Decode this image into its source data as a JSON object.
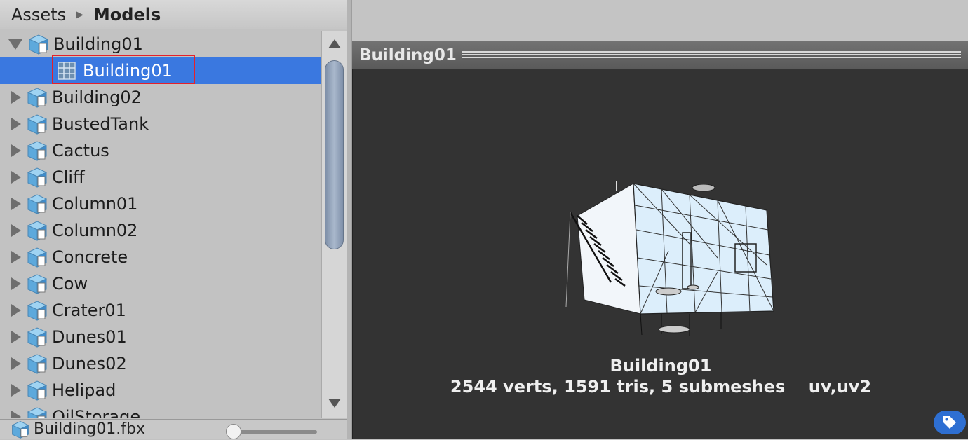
{
  "breadcrumb": {
    "root": "Assets",
    "current": "Models"
  },
  "tree": {
    "expanded_item": "Building01",
    "child_mesh": "Building01",
    "items": [
      "Building02",
      "BustedTank",
      "Cactus",
      "Cliff",
      "Column01",
      "Column02",
      "Concrete",
      "Cow",
      "Crater01",
      "Dunes01",
      "Dunes02",
      "Helipad",
      "OilStorage"
    ]
  },
  "bottom": {
    "selected_file": "Building01.fbx",
    "zoom_fraction": 0.0
  },
  "preview": {
    "title": "Building01",
    "mesh_name": "Building01",
    "stats": "2544 verts, 1591 tris, 5 submeshes    uv,uv2"
  },
  "icons": {
    "model": "model-cube-icon",
    "mesh": "mesh-grid-icon",
    "tag": "tag-icon"
  },
  "colors": {
    "selection": "#3a78e0",
    "highlight": "#e5202a",
    "preview_bg": "#333333"
  }
}
